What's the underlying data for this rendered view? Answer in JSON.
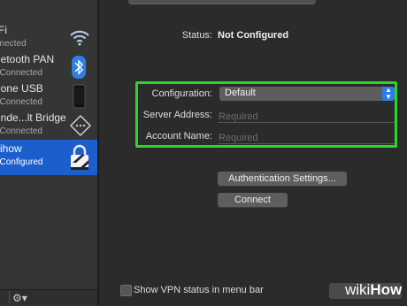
{
  "sidebar": {
    "services": [
      {
        "name": "-Fi",
        "status": "nnected",
        "icon": "wifi-icon"
      },
      {
        "name": "uetooth PAN",
        "status": "t Connected",
        "icon": "bluetooth-icon"
      },
      {
        "name": "hone USB",
        "status": "t Connected",
        "icon": "iphone-icon"
      },
      {
        "name": "unde...lt Bridge",
        "status": "t Connected",
        "icon": "thunderbolt-bridge-icon"
      },
      {
        "name": "kihow",
        "status": "t Configured",
        "icon": "vpn-lock-icon"
      }
    ],
    "bottom_icon": "gear-icon"
  },
  "main": {
    "status_label": "Status:",
    "status_value": "Not Configured",
    "configuration_label": "Configuration:",
    "configuration_value": "Default",
    "server_address_label": "Server Address:",
    "server_address_placeholder": "Required",
    "account_name_label": "Account Name:",
    "account_name_placeholder": "Required",
    "auth_settings_button": "Authentication Settings...",
    "connect_button": "Connect",
    "show_vpn_status_label": "Show VPN status in menu bar"
  },
  "watermark": {
    "prefix": "wiki",
    "suffix": "How"
  },
  "colors": {
    "accent": "#1c5fcc",
    "highlight": "#2bd62b",
    "select_arrow": "#2d7be5"
  }
}
